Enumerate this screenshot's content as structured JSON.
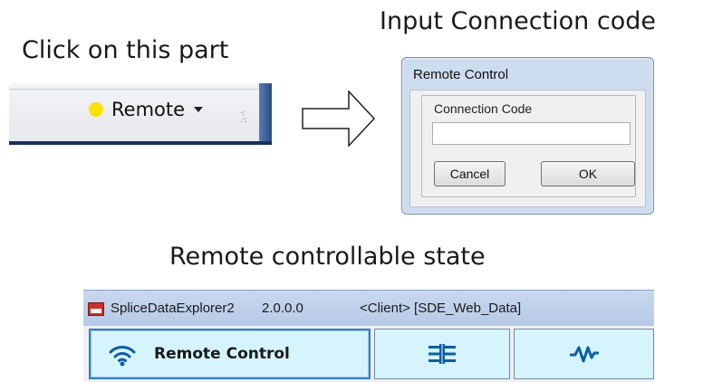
{
  "captions": {
    "click": "Click on this part",
    "input": "Input Connection code",
    "state": "Remote controllable state"
  },
  "statusbar": {
    "remote_label": "Remote",
    "indicator_color": "#ffe100",
    "icons": [
      "status-dot-icon",
      "dropdown-arrow-icon",
      "resize-grip-icon"
    ]
  },
  "dialog": {
    "title": "Remote Control",
    "group_label": "Connection Code",
    "input_value": "",
    "cancel_label": "Cancel",
    "ok_label": "OK"
  },
  "app": {
    "name": "SpliceDataExplorer2",
    "version": "2.0.0.0",
    "info": "<Client>  [SDE_Web_Data]",
    "toolbar": {
      "remote_label": "Remote Control",
      "icons": [
        "wifi-icon",
        "splice-icon",
        "waveform-icon"
      ],
      "button_color": "#d6f4fb",
      "accent_color": "#0e5fa0"
    }
  }
}
